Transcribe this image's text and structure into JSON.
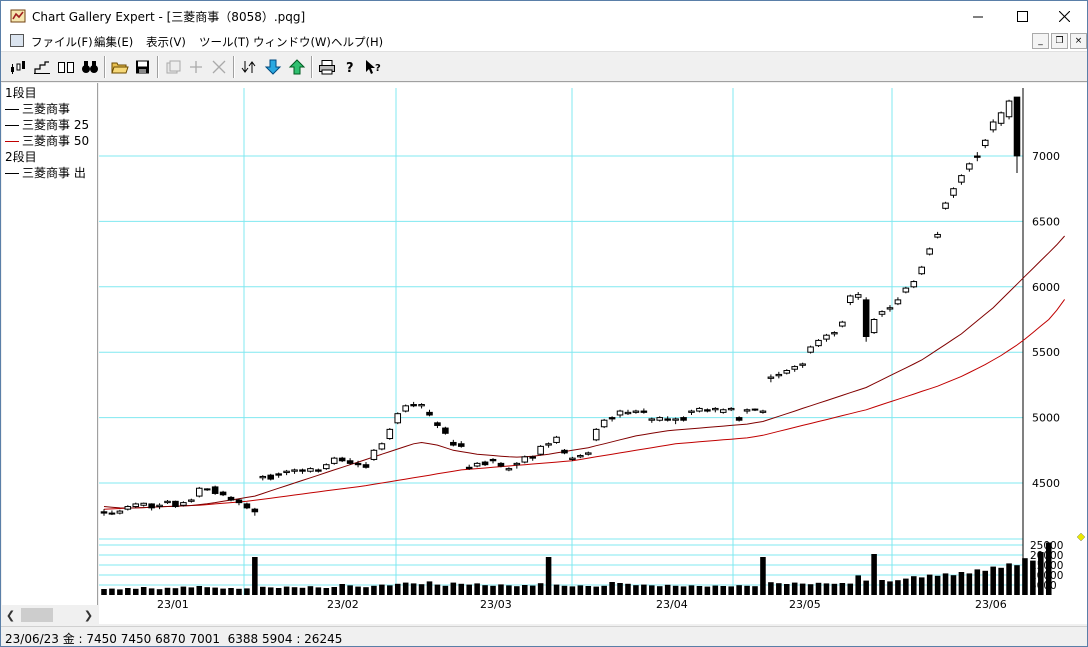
{
  "window": {
    "title": "Chart Gallery Expert - [三菱商事（8058）.pqg]"
  },
  "menu": {
    "items": [
      "ファイル(F)",
      "編集(E)",
      "表示(V)",
      "ツール(T)",
      "ウィンドウ(W)",
      "ヘルプ(H)"
    ]
  },
  "legend": {
    "items": [
      {
        "label": "1段目",
        "line": false,
        "color": ""
      },
      {
        "label": "三菱商事",
        "line": true,
        "color": "#000000"
      },
      {
        "label": "三菱商事 25",
        "line": true,
        "color": "#000000"
      },
      {
        "label": "三菱商事 50",
        "line": true,
        "color": "#c00000"
      },
      {
        "label": "2段目",
        "line": false,
        "color": ""
      },
      {
        "label": "三菱商事 出",
        "line": true,
        "color": "#000000"
      }
    ]
  },
  "status": {
    "text": "23/06/23 金 : 7450 7450 6870 7001  6388 5904 : 26245"
  },
  "chart_data": {
    "type": "candlestick",
    "price_ticks": [
      4500,
      5000,
      5500,
      6000,
      6500,
      7000
    ],
    "volume_ticks": [
      "25000",
      "20000",
      "15000",
      "10000",
      "5000"
    ],
    "x_tick_labels": [
      "23/01",
      "23/02",
      "23/03",
      "23/04",
      "23/05",
      "23/06"
    ],
    "colors": {
      "grid": "#80e8f0",
      "ma25": "#800000",
      "ma50": "#c00000",
      "candle": "#000000",
      "marker": "#e8e800"
    },
    "last_bar": {
      "date": "23/06/23",
      "open": 7450,
      "high": 7450,
      "low": 6870,
      "close": 7001,
      "ma25": 6388,
      "ma50": 5904,
      "volume": 26245
    },
    "candles": [
      [
        4280,
        4300,
        4250,
        4270
      ],
      [
        4270,
        4290,
        4255,
        4265
      ],
      [
        4270,
        4295,
        4260,
        4285
      ],
      [
        4300,
        4330,
        4290,
        4320
      ],
      [
        4320,
        4350,
        4310,
        4340
      ],
      [
        4330,
        4350,
        4320,
        4345
      ],
      [
        4340,
        4345,
        4290,
        4310
      ],
      [
        4320,
        4345,
        4300,
        4330
      ],
      [
        4350,
        4370,
        4340,
        4360
      ],
      [
        4360,
        4365,
        4310,
        4320
      ],
      [
        4330,
        4360,
        4320,
        4350
      ],
      [
        4360,
        4380,
        4350,
        4370
      ],
      [
        4400,
        4470,
        4390,
        4460
      ],
      [
        4450,
        4460,
        4440,
        4455
      ],
      [
        4470,
        4480,
        4410,
        4420
      ],
      [
        4430,
        4440,
        4400,
        4410
      ],
      [
        4390,
        4400,
        4360,
        4370
      ],
      [
        4370,
        4380,
        4330,
        4350
      ],
      [
        4340,
        4350,
        4300,
        4310
      ],
      [
        4300,
        4310,
        4250,
        4280
      ],
      [
        4540,
        4560,
        4520,
        4550
      ],
      [
        4560,
        4570,
        4520,
        4530
      ],
      [
        4570,
        4580,
        4540,
        4560
      ],
      [
        4580,
        4600,
        4560,
        4590
      ],
      [
        4590,
        4610,
        4570,
        4600
      ],
      [
        4600,
        4610,
        4570,
        4590
      ],
      [
        4590,
        4620,
        4580,
        4610
      ],
      [
        4600,
        4610,
        4580,
        4590
      ],
      [
        4610,
        4650,
        4600,
        4640
      ],
      [
        4650,
        4700,
        4640,
        4690
      ],
      [
        4690,
        4700,
        4660,
        4670
      ],
      [
        4670,
        4690,
        4640,
        4650
      ],
      [
        4650,
        4670,
        4620,
        4640
      ],
      [
        4640,
        4660,
        4610,
        4620
      ],
      [
        4680,
        4760,
        4670,
        4750
      ],
      [
        4760,
        4810,
        4750,
        4800
      ],
      [
        4840,
        4920,
        4830,
        4910
      ],
      [
        4960,
        5040,
        4950,
        5030
      ],
      [
        5050,
        5100,
        5040,
        5090
      ],
      [
        5100,
        5120,
        5080,
        5090
      ],
      [
        5090,
        5110,
        5070,
        5100
      ],
      [
        5040,
        5060,
        5010,
        5020
      ],
      [
        4960,
        4970,
        4920,
        4940
      ],
      [
        4920,
        4930,
        4870,
        4880
      ],
      [
        4810,
        4830,
        4780,
        4790
      ],
      [
        4800,
        4820,
        4770,
        4780
      ],
      [
        4620,
        4640,
        4600,
        4610
      ],
      [
        4630,
        4660,
        4620,
        4650
      ],
      [
        4660,
        4670,
        4630,
        4640
      ],
      [
        4680,
        4690,
        4650,
        4670
      ],
      [
        4650,
        4660,
        4620,
        4630
      ],
      [
        4600,
        4620,
        4590,
        4610
      ],
      [
        4640,
        4660,
        4610,
        4650
      ],
      [
        4660,
        4710,
        4650,
        4700
      ],
      [
        4700,
        4710,
        4670,
        4690
      ],
      [
        4720,
        4790,
        4710,
        4780
      ],
      [
        4790,
        4810,
        4770,
        4800
      ],
      [
        4810,
        4860,
        4800,
        4850
      ],
      [
        4750,
        4760,
        4720,
        4730
      ],
      [
        4680,
        4700,
        4670,
        4690
      ],
      [
        4700,
        4720,
        4690,
        4710
      ],
      [
        4720,
        4740,
        4710,
        4730
      ],
      [
        4830,
        4920,
        4820,
        4910
      ],
      [
        4930,
        4990,
        4920,
        4980
      ],
      [
        5000,
        5010,
        4970,
        4990
      ],
      [
        5020,
        5060,
        5000,
        5050
      ],
      [
        5030,
        5060,
        5020,
        5040
      ],
      [
        5040,
        5060,
        5030,
        5050
      ],
      [
        5050,
        5070,
        5030,
        5040
      ],
      [
        4980,
        5000,
        4960,
        4990
      ],
      [
        4980,
        5010,
        4970,
        5000
      ],
      [
        4990,
        5010,
        4970,
        4980
      ],
      [
        4980,
        5000,
        4950,
        4990
      ],
      [
        5000,
        5010,
        4970,
        4980
      ],
      [
        5040,
        5060,
        5020,
        5050
      ],
      [
        5050,
        5080,
        5040,
        5070
      ],
      [
        5060,
        5070,
        5040,
        5050
      ],
      [
        5060,
        5080,
        5040,
        5070
      ],
      [
        5040,
        5070,
        5030,
        5060
      ],
      [
        5060,
        5080,
        5050,
        5070
      ],
      [
        5000,
        5010,
        4970,
        4980
      ],
      [
        5050,
        5070,
        5030,
        5060
      ],
      [
        5060,
        5070,
        5050,
        5065
      ],
      [
        5040,
        5060,
        5030,
        5050
      ],
      [
        5300,
        5330,
        5270,
        5310
      ],
      [
        5320,
        5350,
        5300,
        5330
      ],
      [
        5340,
        5370,
        5330,
        5360
      ],
      [
        5370,
        5400,
        5350,
        5390
      ],
      [
        5400,
        5420,
        5380,
        5410
      ],
      [
        5500,
        5550,
        5490,
        5540
      ],
      [
        5550,
        5600,
        5540,
        5590
      ],
      [
        5600,
        5640,
        5580,
        5630
      ],
      [
        5640,
        5660,
        5620,
        5650
      ],
      [
        5700,
        5740,
        5690,
        5730
      ],
      [
        5880,
        5940,
        5860,
        5930
      ],
      [
        5920,
        5960,
        5900,
        5940
      ],
      [
        5900,
        5920,
        5580,
        5620
      ],
      [
        5650,
        5760,
        5640,
        5750
      ],
      [
        5790,
        5820,
        5770,
        5810
      ],
      [
        5830,
        5860,
        5810,
        5840
      ],
      [
        5870,
        5920,
        5860,
        5900
      ],
      [
        5960,
        6000,
        5950,
        5990
      ],
      [
        6000,
        6050,
        5990,
        6040
      ],
      [
        6100,
        6160,
        6090,
        6150
      ],
      [
        6250,
        6300,
        6240,
        6290
      ],
      [
        6380,
        6420,
        6370,
        6400
      ],
      [
        6600,
        6650,
        6590,
        6640
      ],
      [
        6700,
        6760,
        6680,
        6750
      ],
      [
        6800,
        6860,
        6780,
        6850
      ],
      [
        6900,
        6950,
        6880,
        6940
      ],
      [
        7000,
        7030,
        6960,
        6990
      ],
      [
        7080,
        7130,
        7060,
        7120
      ],
      [
        7200,
        7280,
        7180,
        7260
      ],
      [
        7250,
        7340,
        7230,
        7330
      ],
      [
        7300,
        7430,
        7280,
        7420
      ],
      [
        7450,
        7450,
        6870,
        7001
      ]
    ],
    "ma25": [
      4320,
      4315,
      4310,
      4308,
      4310,
      4312,
      4315,
      4318,
      4320,
      4322,
      4325,
      4328,
      4335,
      4342,
      4350,
      4360,
      4370,
      4380,
      4390,
      4400,
      4420,
      4440,
      4460,
      4480,
      4500,
      4520,
      4540,
      4560,
      4580,
      4600,
      4620,
      4640,
      4660,
      4680,
      4700,
      4720,
      4740,
      4760,
      4780,
      4800,
      4810,
      4800,
      4790,
      4770,
      4750,
      4740,
      4730,
      4720,
      4715,
      4710,
      4705,
      4700,
      4698,
      4700,
      4705,
      4712,
      4720,
      4730,
      4740,
      4750,
      4760,
      4770,
      4785,
      4800,
      4815,
      4830,
      4845,
      4860,
      4870,
      4880,
      4890,
      4900,
      4905,
      4910,
      4915,
      4920,
      4925,
      4930,
      4935,
      4940,
      4945,
      4950,
      4960,
      4970,
      4990,
      5010,
      5030,
      5050,
      5070,
      5090,
      5110,
      5130,
      5150,
      5170,
      5190,
      5210,
      5230,
      5260,
      5290,
      5320,
      5350,
      5380,
      5410,
      5440,
      5480,
      5520,
      5560,
      5600,
      5640,
      5690,
      5740,
      5790,
      5840,
      5900,
      5960,
      6020,
      6080,
      6140,
      6200,
      6260,
      6320,
      6388
    ],
    "ma50": [
      4300,
      4302,
      4305,
      4308,
      4310,
      4312,
      4315,
      4318,
      4320,
      4322,
      4325,
      4328,
      4330,
      4335,
      4340,
      4345,
      4350,
      4355,
      4360,
      4368,
      4376,
      4384,
      4392,
      4400,
      4408,
      4416,
      4424,
      4432,
      4440,
      4448,
      4456,
      4464,
      4472,
      4480,
      4490,
      4500,
      4510,
      4520,
      4530,
      4540,
      4550,
      4560,
      4570,
      4580,
      4590,
      4600,
      4605,
      4610,
      4615,
      4620,
      4625,
      4630,
      4635,
      4640,
      4645,
      4650,
      4655,
      4660,
      4665,
      4670,
      4680,
      4690,
      4700,
      4710,
      4720,
      4730,
      4740,
      4750,
      4760,
      4770,
      4780,
      4790,
      4800,
      4805,
      4810,
      4815,
      4820,
      4825,
      4830,
      4835,
      4840,
      4845,
      4855,
      4865,
      4880,
      4895,
      4910,
      4925,
      4940,
      4955,
      4970,
      4985,
      5000,
      5015,
      5030,
      5045,
      5060,
      5080,
      5100,
      5120,
      5140,
      5160,
      5180,
      5200,
      5220,
      5240,
      5265,
      5290,
      5315,
      5345,
      5375,
      5405,
      5440,
      5475,
      5515,
      5555,
      5600,
      5650,
      5700,
      5750,
      5820,
      5904
    ],
    "volumes": [
      3000,
      3200,
      2800,
      3500,
      3100,
      4000,
      3300,
      2900,
      3600,
      3400,
      4200,
      3800,
      4500,
      3900,
      3700,
      3200,
      3500,
      3100,
      3300,
      19000,
      4100,
      3800,
      3500,
      4200,
      3900,
      3600,
      4400,
      3800,
      3500,
      4000,
      5500,
      4800,
      4200,
      3900,
      4600,
      5200,
      4800,
      5600,
      6200,
      5800,
      5400,
      6800,
      5200,
      4600,
      6200,
      5600,
      5200,
      5800,
      4900,
      4600,
      5300,
      4800,
      4400,
      5000,
      4700,
      5900,
      19000,
      5200,
      4600,
      4300,
      4800,
      4500,
      4200,
      4600,
      6500,
      6000,
      5600,
      4900,
      5200,
      4800,
      4400,
      5100,
      4600,
      4300,
      4800,
      4500,
      4200,
      4700,
      4500,
      4300,
      4900,
      4600,
      4400,
      19000,
      6400,
      5900,
      5500,
      6200,
      5700,
      5400,
      6100,
      5800,
      5600,
      6000,
      5700,
      9800,
      7200,
      20500,
      7500,
      6800,
      7400,
      8200,
      9400,
      8800,
      10200,
      9600,
      10800,
      9900,
      11500,
      10800,
      12800,
      12100,
      14200,
      13600,
      15800,
      14900,
      18400,
      17200,
      21500,
      26245
    ]
  }
}
